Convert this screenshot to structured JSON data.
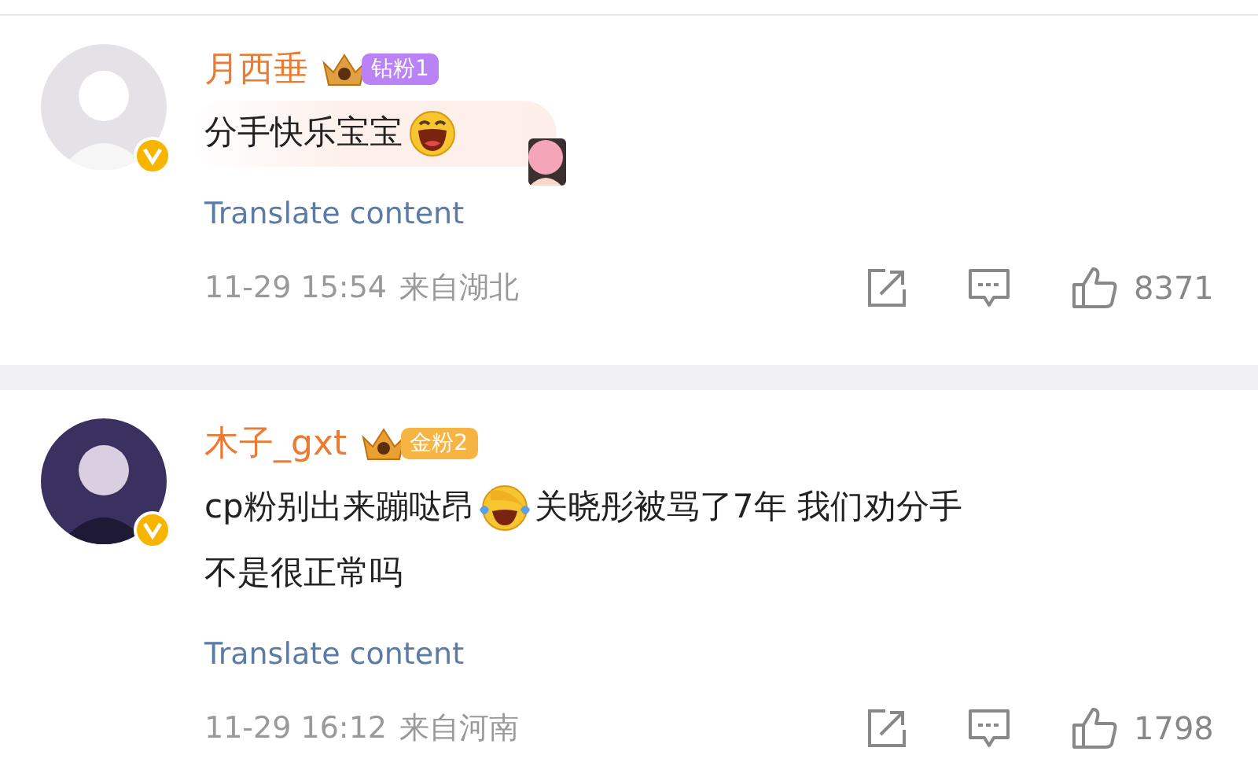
{
  "comments": [
    {
      "author": "月西垂",
      "badge": {
        "kind": "diamond",
        "label": "钻粉1"
      },
      "verified": true,
      "bubble": true,
      "lines": [
        [
          {
            "kind": "text",
            "text": "分手快乐宝宝"
          },
          {
            "kind": "grin"
          }
        ]
      ],
      "translate": "Translate content",
      "time": "11-29 15:54",
      "location": "来自湖北",
      "likes": "8371"
    },
    {
      "author": "木子_gxt",
      "badge": {
        "kind": "gold",
        "label": "金粉2"
      },
      "verified": true,
      "bubble": false,
      "lines": [
        [
          {
            "kind": "text",
            "text": "cp粉别出来蹦哒昂"
          },
          {
            "kind": "tears"
          },
          {
            "kind": "text",
            "text": "关晓彤被骂了7年 我们劝分手"
          }
        ],
        [
          {
            "kind": "text",
            "text": "不是很正常吗"
          }
        ]
      ],
      "translate": "Translate content",
      "time": "11-29 16:12",
      "location": "来自河南",
      "likes": "1798"
    }
  ]
}
